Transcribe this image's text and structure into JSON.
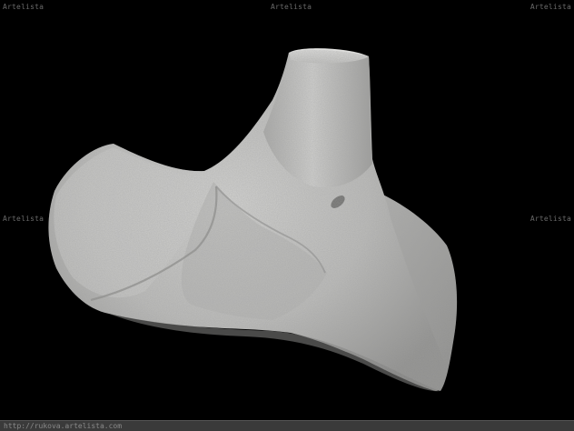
{
  "watermarks": {
    "top_left": "Artelista",
    "top_center": "Artelista",
    "top_right": "Artelista",
    "middle_left": "Artelista",
    "middle_right": "Artelista"
  },
  "footer": {
    "url": "http://rukova.artelista.com"
  },
  "photo": {
    "subject": "stone-sculpture",
    "background_color": "#000000",
    "stone_color": "#c8c8c8"
  }
}
